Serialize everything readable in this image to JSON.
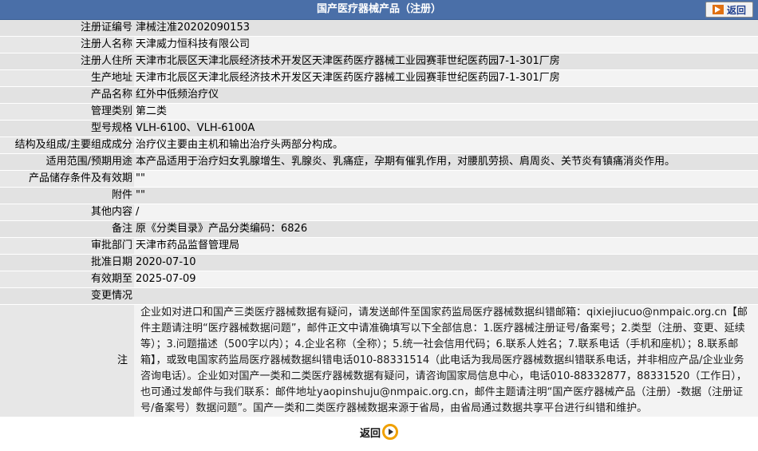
{
  "header": {
    "title": "国产医疗器械产品（注册）",
    "back_label": "返回"
  },
  "rows": [
    {
      "label": "注册证编号",
      "value": "津械注准20202090153"
    },
    {
      "label": "注册人名称",
      "value": "天津威力恒科技有限公司"
    },
    {
      "label": "注册人住所",
      "value": "天津市北辰区天津北辰经济技术开发区天津医药医疗器械工业园赛菲世纪医药园7-1-301厂房"
    },
    {
      "label": "生产地址",
      "value": "天津市北辰区天津北辰经济技术开发区天津医药医疗器械工业园赛菲世纪医药园7-1-301厂房"
    },
    {
      "label": "产品名称",
      "value": "红外中低频治疗仪"
    },
    {
      "label": "管理类别",
      "value": "第二类"
    },
    {
      "label": "型号规格",
      "value": "VLH-6100、VLH-6100A"
    },
    {
      "label": "结构及组成/主要组成成分",
      "value": "治疗仪主要由主机和输出治疗头两部分构成。"
    },
    {
      "label": "适用范围/预期用途",
      "value": "本产品适用于治疗妇女乳腺增生、乳腺炎、乳痛症，孕期有催乳作用，对腰肌劳损、肩周炎、关节炎有镇痛消炎作用。"
    },
    {
      "label": "产品储存条件及有效期",
      "value": "\"\""
    },
    {
      "label": "附件",
      "value": "\"\""
    },
    {
      "label": "其他内容",
      "value": "/"
    },
    {
      "label": "备注",
      "value": "原《分类目录》产品分类编码：6826"
    },
    {
      "label": "审批部门",
      "value": "天津市药品监督管理局"
    },
    {
      "label": "批准日期",
      "value": "2020-07-10"
    },
    {
      "label": "有效期至",
      "value": "2025-07-09"
    },
    {
      "label": "变更情况",
      "value": ""
    }
  ],
  "note": {
    "label": "注",
    "text": "企业如对进口和国产三类医疗器械数据有疑问，请发送邮件至国家药监局医疗器械数据纠错邮箱：qixiejiucuo@nmpaic.org.cn【邮件主题请注明“医疗器械数据问题”，邮件正文中请准确填写以下全部信息：1.医疗器械注册证号/备案号；2.类型（注册、变更、延续等）；3.问题描述（500字以内）；4.企业名称（全称）；5.统一社会信用代码；6.联系人姓名；7.联系电话（手机和座机）；8.联系邮箱】，或致电国家药监局医疗器械数据纠错电话010-88331514（此电话为我局医疗器械数据纠错联系电话，并非相应产品/企业业务咨询电话）。企业如对国产一类和二类医疗器械数据有疑问，请咨询国家局信息中心，电话010-88332877，88331520（工作日），也可通过发邮件与我们联系：邮件地址yaopinshuju@nmpaic.org.cn，邮件主题请注明“国产医疗器械产品（注册）-数据（注册证号/备案号）数据问题”。国产一类和二类医疗器械数据来源于省局，由省局通过数据共享平台进行纠错和维护。"
  },
  "footer": {
    "back_label": "返回"
  }
}
